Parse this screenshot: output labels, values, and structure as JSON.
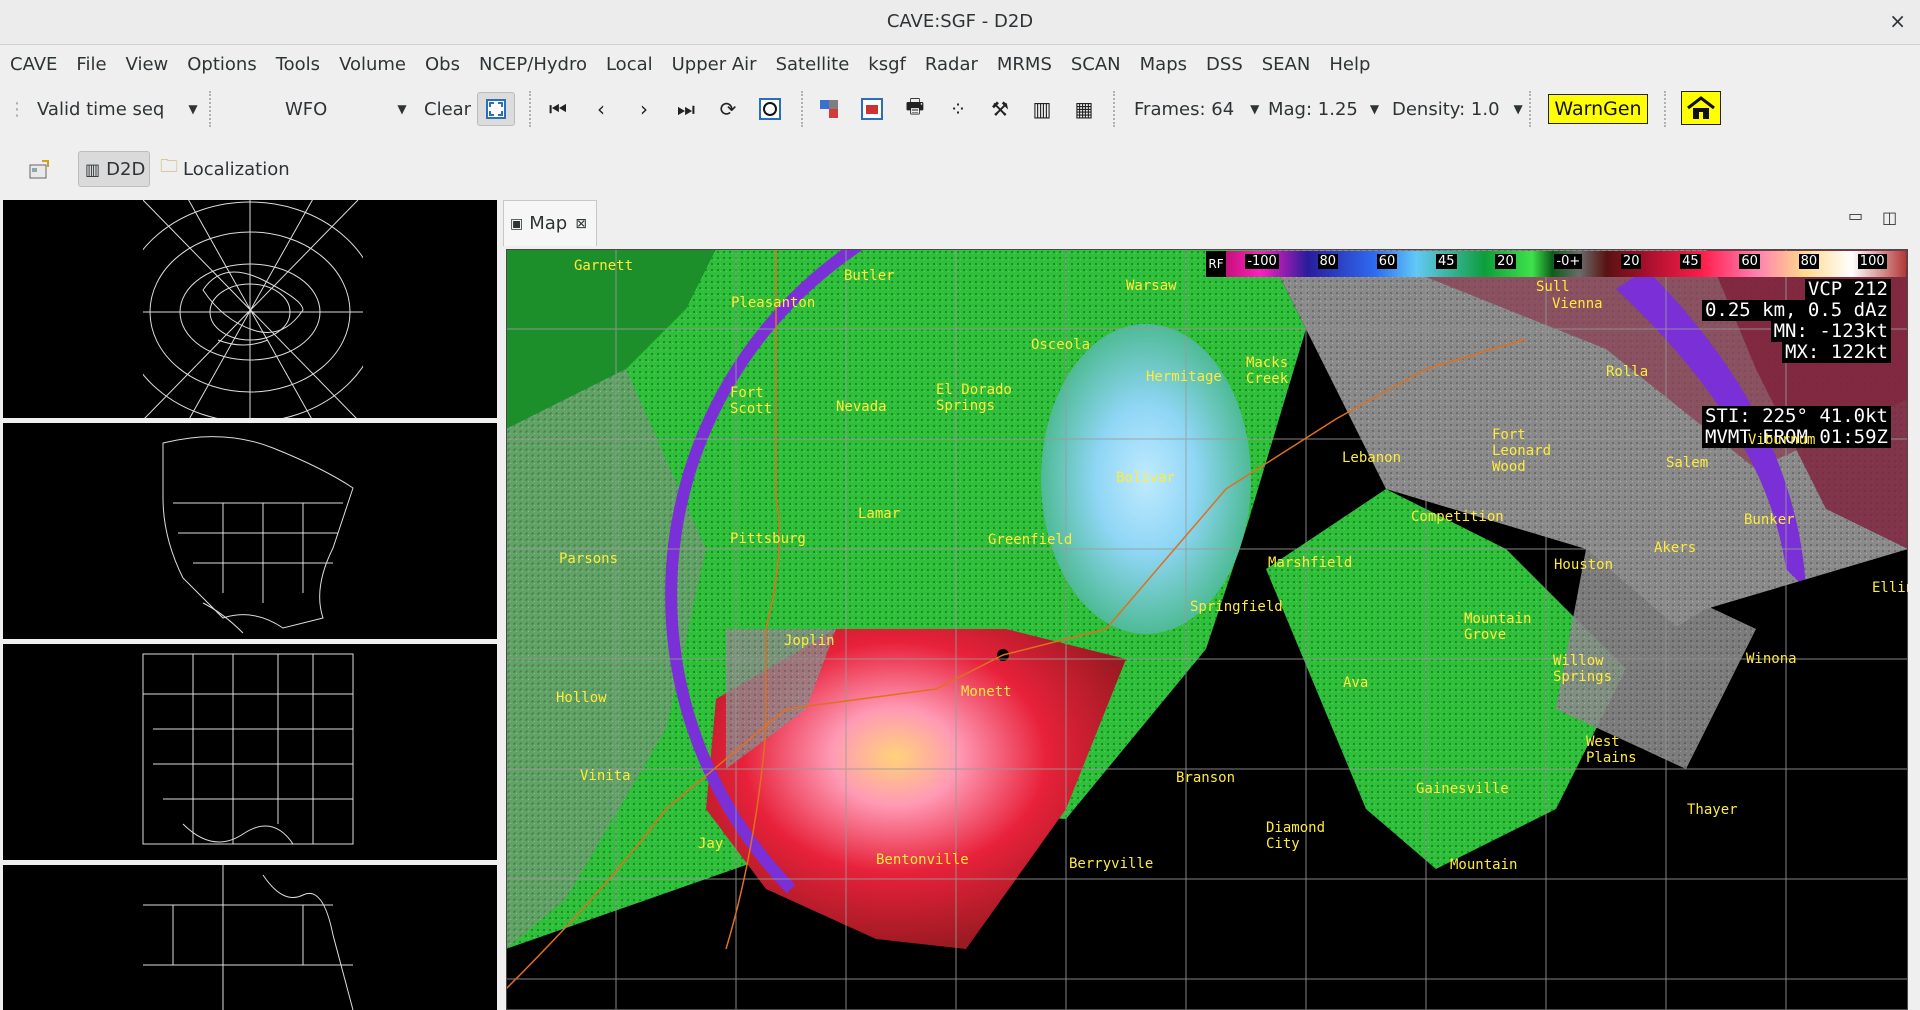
{
  "window": {
    "title": "CAVE:SGF - D2D",
    "close": "×"
  },
  "menubar": [
    "CAVE",
    "File",
    "View",
    "Options",
    "Tools",
    "Volume",
    "Obs",
    "NCEP/Hydro",
    "Local",
    "Upper Air",
    "Satellite",
    "ksgf",
    "Radar",
    "MRMS",
    "SCAN",
    "Maps",
    "DSS",
    "SEAN",
    "Help"
  ],
  "toolbar": {
    "time_mode": "Valid time seq",
    "site_mode": "WFO",
    "clear": "Clear",
    "frames": "Frames: 64",
    "mag": "Mag: 1.25",
    "density": "Density: 1.0",
    "warngen": "WarnGen"
  },
  "perspectives": {
    "d2d": "D2D",
    "localization": "Localization"
  },
  "map_tab": {
    "label": "Map"
  },
  "colorbar": {
    "prefix": "RF",
    "labels": [
      "-100",
      "80",
      "60",
      "45",
      "20",
      "-0+",
      "20",
      "45",
      "60",
      "80",
      "100"
    ]
  },
  "radar_info": {
    "vcp": "VCP 212",
    "product": "0.25 km, 0.5 dAz",
    "mn": "MN: -123kt",
    "mx": "MX: 122kt",
    "sti": "STI:  225°  41.0kt",
    "mvmt": "MVMT FROM 01:59Z"
  },
  "cities": {
    "garnett": "Garnett",
    "butler": "Butler",
    "warsaw": "Warsaw",
    "sullivan": "Sull",
    "vienna": "Vienna",
    "pleasanton": "Pleasanton",
    "osceola": "Osceola",
    "rolla": "Rolla",
    "hermitage": "Hermitage",
    "wheatland": "Macks\nCreek",
    "fort_scott": "Fort\nScott",
    "nevada": "Nevada",
    "el_dorado": "El Dorado\nSprings",
    "fort_leonard": "Fort\nLeonard\nWood",
    "viburnum": "Viburnum",
    "lebanon": "Lebanon",
    "salem": "Salem",
    "bolivar": "Bolivar",
    "lamar": "Lamar",
    "competition": "Competition",
    "bunker": "Bunker",
    "pittsburg": "Pittsburg",
    "greenfield": "Greenfield",
    "parsons": "Parsons",
    "akers": "Akers",
    "marshfield": "Marshfield",
    "houston": "Houston",
    "ellington": "Ellin",
    "springfield": "Springfield",
    "mountain_grove": "Mountain\nGrove",
    "joplin": "Joplin",
    "winona": "Winona",
    "willow_springs": "Willow\nSprings",
    "hollow": "Hollow",
    "monett": "Monett",
    "ava": "Ava",
    "west_plains": "West\nPlains",
    "vinita": "Vinita",
    "branson": "Branson",
    "gainesville": "Gainesville",
    "thayer": "Thayer",
    "jay": "Jay",
    "diamond_city": "Diamond\nCity",
    "bentonville": "Bentonville",
    "berryville": "Berryville",
    "mountain": "Mountain"
  },
  "colors": {
    "warngen_bg": "#ffff00",
    "city_text": "#ffeb3b",
    "highway": "#e0701f"
  }
}
